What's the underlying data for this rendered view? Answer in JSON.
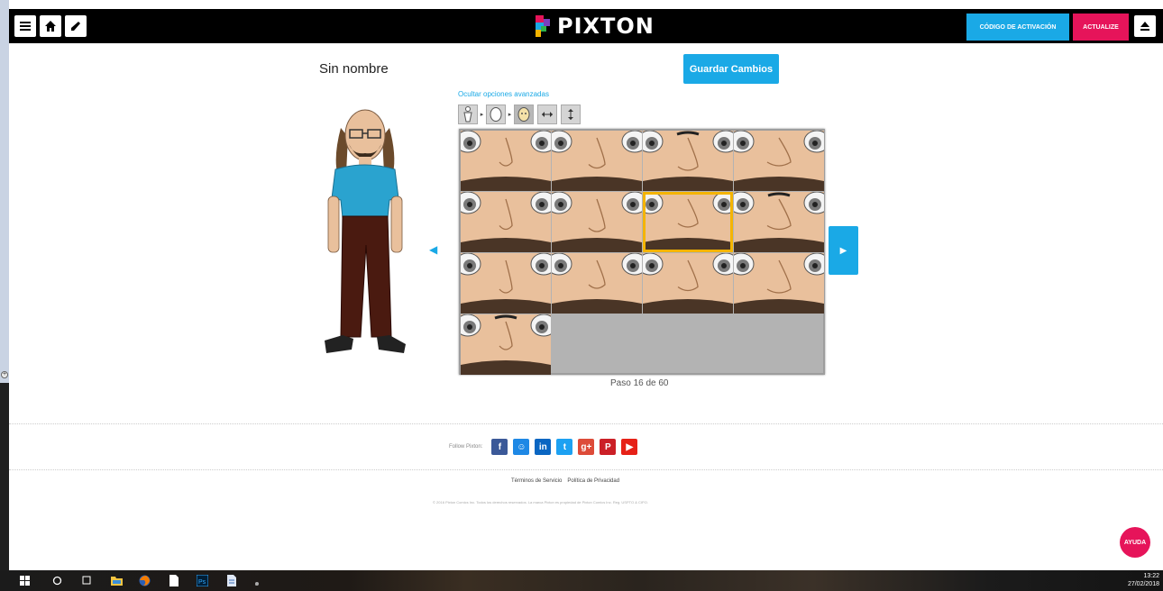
{
  "app": {
    "logo_text": "PIXTON",
    "activation_label": "CÓDIGO DE ACTIVACIÓN",
    "update_label": "ACTUALIZE"
  },
  "editor": {
    "character_name": "Sin nombre",
    "save_label": "Guardar Cambios",
    "advanced_link": "Ocultar opciones avanzadas",
    "step_text": "Paso 16 de 60",
    "breadcrumb_icons": [
      "body-icon",
      "head-icon",
      "face-icon",
      "width-icon",
      "height-icon"
    ],
    "grid_option_count": 13,
    "selected_option_index": 6
  },
  "footer": {
    "follow_label": "Follow Pixton:",
    "social": [
      {
        "name": "facebook",
        "glyph": "f",
        "color": "#3b5998"
      },
      {
        "name": "messenger",
        "glyph": "☺",
        "color": "#1e88e5"
      },
      {
        "name": "linkedin",
        "glyph": "in",
        "color": "#0a66c2"
      },
      {
        "name": "twitter",
        "glyph": "t",
        "color": "#1da1f2"
      },
      {
        "name": "google-plus",
        "glyph": "g+",
        "color": "#dd4b39"
      },
      {
        "name": "pinterest",
        "glyph": "P",
        "color": "#cb2027"
      },
      {
        "name": "youtube",
        "glyph": "▶",
        "color": "#e62117"
      }
    ],
    "terms_label": "Términos de Servicio",
    "privacy_label": "Política de Privacidad",
    "copyright": "© 2016 Pixton Comics Inc. Todos los derechos reservados. La marca Pixton es propiedad de Pixton Comics Inc. Reg. USPTO & CIPO."
  },
  "help_label": "AYUDA",
  "taskbar": {
    "time": "13:22",
    "date": "27/02/2018"
  },
  "colors": {
    "accent": "#1aa9e6",
    "brand_pink": "#e6145a",
    "skin": "#e9c09c",
    "selection": "#f4b400"
  }
}
